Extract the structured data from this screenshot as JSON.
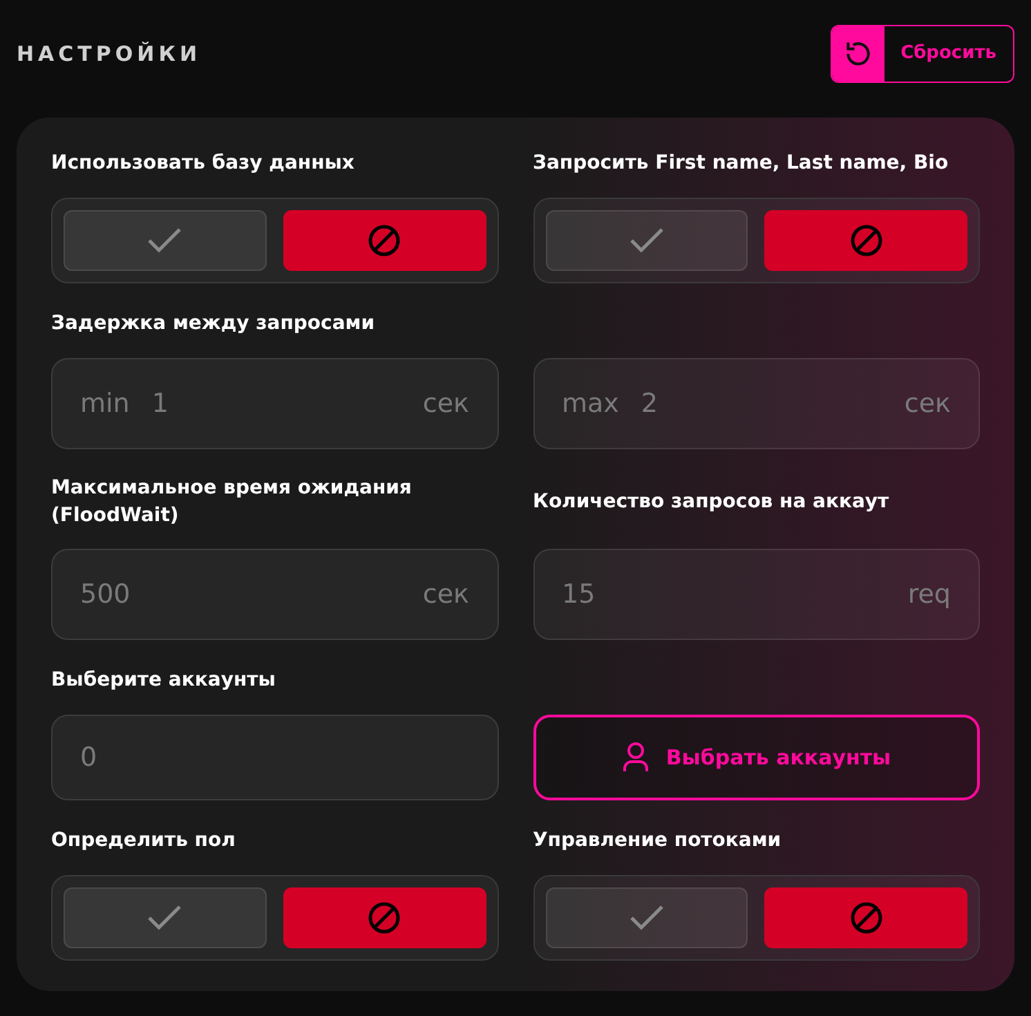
{
  "header": {
    "title": "НАСТРОЙКИ",
    "reset_button": {
      "label": "Сбросить"
    }
  },
  "rows": [
    {
      "items": [
        {
          "kind": "toggle",
          "label": "Использовать базу данных",
          "enabled": false
        },
        {
          "kind": "toggle",
          "label": "Запросить First name, Last name, Bio",
          "enabled": false
        }
      ]
    },
    {
      "items": [
        {
          "kind": "field",
          "label": "Задержка между запросами",
          "prefix": "min",
          "value": "1",
          "unit": "сек"
        },
        {
          "kind": "field",
          "prefix": "max",
          "value": "2",
          "unit": "сек"
        }
      ]
    },
    {
      "items": [
        {
          "kind": "field",
          "label": "Максимальное время ожидания (FloodWait)",
          "value": "500",
          "unit": "сек"
        },
        {
          "kind": "field",
          "label": "Количество запросов на аккаут",
          "value": "15",
          "unit": "req"
        }
      ]
    },
    {
      "items": [
        {
          "kind": "field",
          "label": "Выберите аккаунты",
          "value": "0"
        },
        {
          "kind": "button",
          "label": "Выбрать аккаунты"
        }
      ]
    },
    {
      "items": [
        {
          "kind": "toggle",
          "label": "Определить пол",
          "enabled": false
        },
        {
          "kind": "toggle",
          "label": "Управление потоками",
          "enabled": false
        }
      ]
    }
  ]
}
